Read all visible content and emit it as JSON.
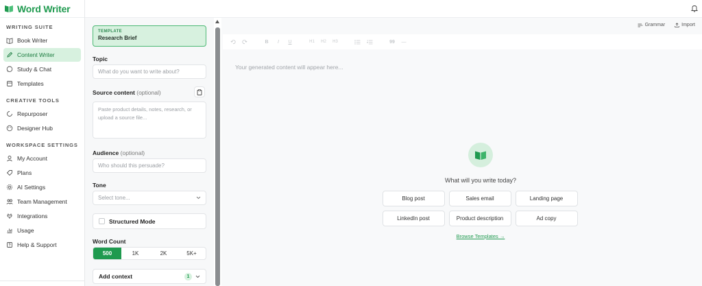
{
  "app": {
    "name": "Word Writer"
  },
  "sidebar": {
    "sections": [
      {
        "label": "WRITING SUITE",
        "items": [
          {
            "label": "Book Writer",
            "icon": "book-icon"
          },
          {
            "label": "Content Writer",
            "icon": "pencil-icon",
            "active": true
          },
          {
            "label": "Study & Chat",
            "icon": "chat-icon"
          },
          {
            "label": "Templates",
            "icon": "templates-icon"
          }
        ]
      },
      {
        "label": "CREATIVE TOOLS",
        "items": [
          {
            "label": "Repurposer",
            "icon": "refresh-icon"
          },
          {
            "label": "Designer Hub",
            "icon": "palette-icon"
          }
        ]
      },
      {
        "label": "WORKSPACE SETTINGS",
        "items": [
          {
            "label": "My Account",
            "icon": "user-icon"
          },
          {
            "label": "Plans",
            "icon": "tag-icon"
          },
          {
            "label": "AI Settings",
            "icon": "gear-icon"
          },
          {
            "label": "Team Management",
            "icon": "team-icon"
          },
          {
            "label": "Integrations",
            "icon": "plug-icon"
          },
          {
            "label": "Usage",
            "icon": "chart-icon"
          },
          {
            "label": "Help & Support",
            "icon": "help-icon"
          }
        ]
      }
    ]
  },
  "form": {
    "template_eyebrow": "TEMPLATE",
    "template_name": "Research Brief",
    "topic_label": "Topic",
    "topic_placeholder": "What do you want to write about?",
    "source_label": "Source content",
    "source_optional": "(optional)",
    "source_placeholder": "Paste product details, notes, research, or upload a source file...",
    "audience_label": "Audience",
    "audience_optional": "(optional)",
    "audience_placeholder": "Who should this persuade?",
    "tone_label": "Tone",
    "tone_placeholder": "Select tone...",
    "structured_label": "Structured Mode",
    "word_count_label": "Word Count",
    "word_count_options": [
      "500",
      "1K",
      "2K",
      "5K+"
    ],
    "word_count_selected": "500",
    "add_context_label": "Add context",
    "add_context_count": "1"
  },
  "editor": {
    "grammar_label": "Grammar",
    "import_label": "Import",
    "toolbar": {
      "bold": "B",
      "italic": "I",
      "underline": "U",
      "h1": "H1",
      "h2": "H2",
      "h3": "H3",
      "quote": "99",
      "rule": "—"
    },
    "placeholder": "Your generated content will appear here...",
    "empty_title": "What will you write today?",
    "quick_starts": [
      "Blog post",
      "Sales email",
      "Landing page",
      "LinkedIn post",
      "Product description",
      "Ad copy"
    ],
    "browse_label": "Browse Templates →"
  },
  "colors": {
    "brand": "#1f9a4f",
    "active_bg": "#d7f1df"
  }
}
